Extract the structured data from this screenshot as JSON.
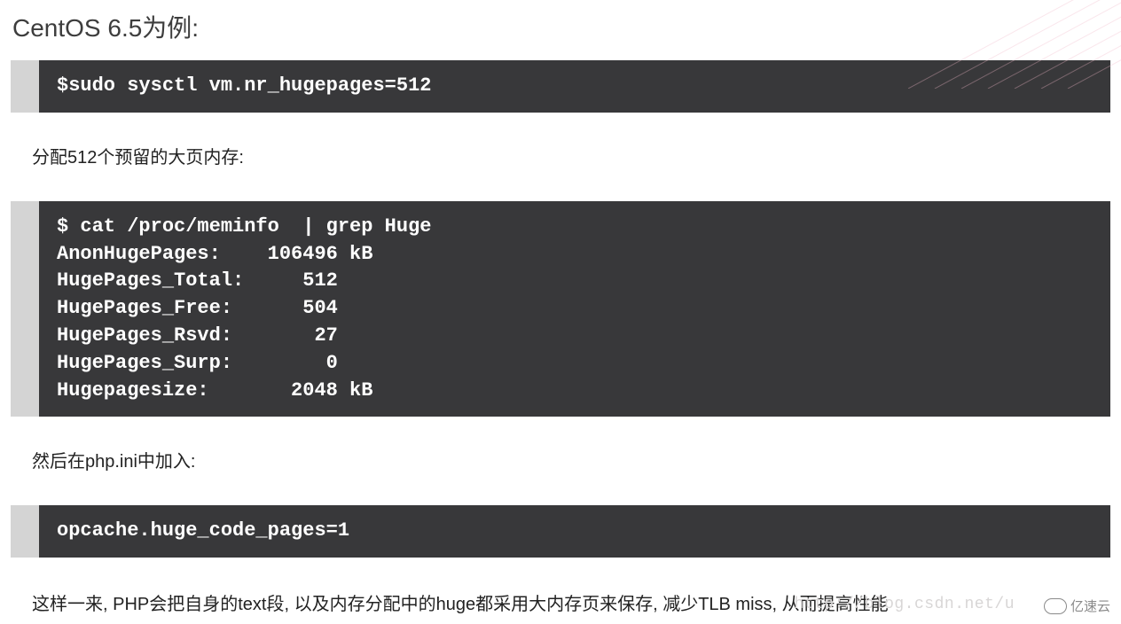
{
  "heading": "CentOS 6.5为例:",
  "code1": "$sudo sysctl vm.nr_hugepages=512",
  "para1": "分配512个预留的大页内存:",
  "code2": "$ cat /proc/meminfo  | grep Huge\nAnonHugePages:    106496 kB\nHugePages_Total:     512\nHugePages_Free:      504\nHugePages_Rsvd:       27\nHugePages_Surp:        0\nHugepagesize:       2048 kB",
  "para2": "然后在php.ini中加入:",
  "code3": "opcache.huge_code_pages=1",
  "para3": "这样一来, PHP会把自身的text段, 以及内存分配中的huge都采用大内存页来保存, 减少TLB miss, 从而提高性能",
  "watermark_url": "http://blog.csdn.net/u",
  "watermark_logo": "亿速云"
}
